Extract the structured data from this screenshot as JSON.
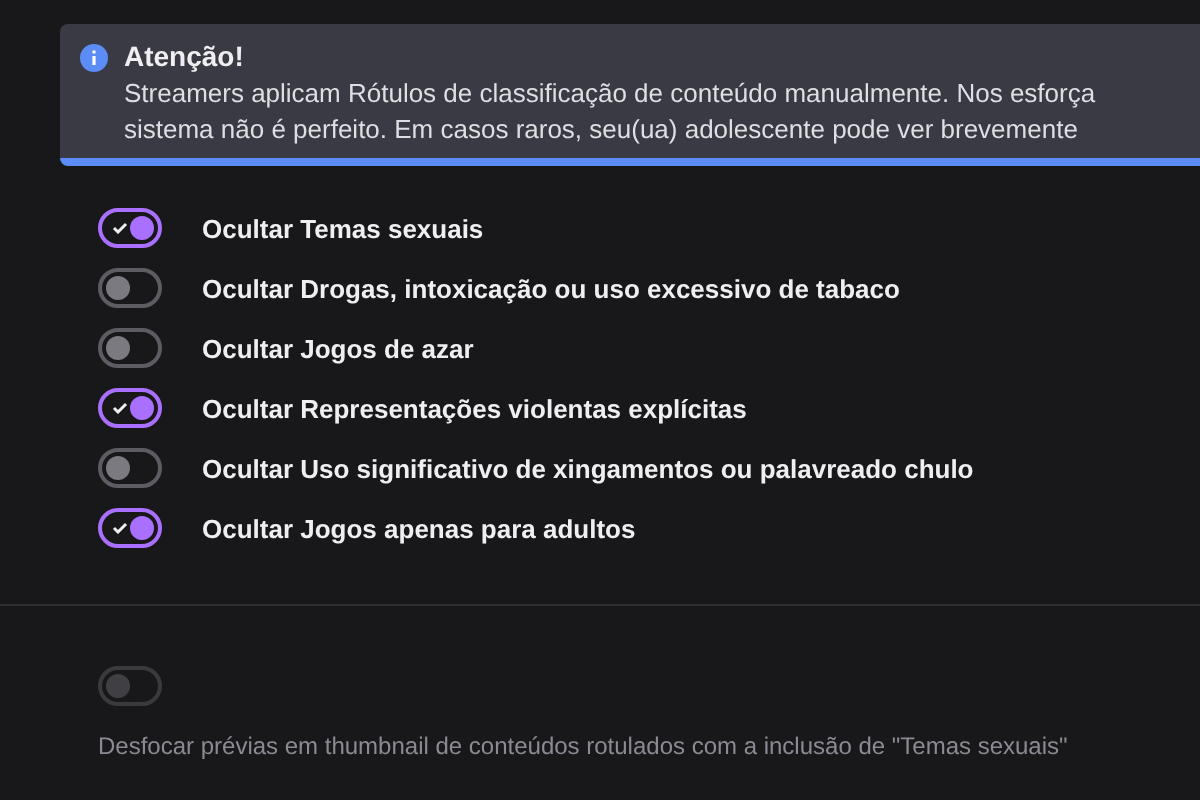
{
  "alert": {
    "title": "Atenção!",
    "lines": [
      "Streamers aplicam Rótulos de classificação de conteúdo manualmente. Nos esforça",
      "sistema não é perfeito. Em casos raros, seu(ua) adolescente pode ver brevemente"
    ]
  },
  "filters": [
    {
      "label": "Ocultar Temas sexuais",
      "checked": true
    },
    {
      "label": "Ocultar Drogas, intoxicação ou uso excessivo de tabaco",
      "checked": false
    },
    {
      "label": "Ocultar Jogos de azar",
      "checked": false
    },
    {
      "label": "Ocultar Representações violentas explícitas",
      "checked": true
    },
    {
      "label": "Ocultar Uso significativo de xingamentos ou palavreado chulo",
      "checked": false
    },
    {
      "label": "Ocultar Jogos apenas para adultos",
      "checked": true
    }
  ],
  "blur": {
    "checked": false,
    "disabled": true,
    "description": "Desfocar prévias em thumbnail de conteúdos rotulados com a inclusão de \"Temas sexuais\""
  }
}
